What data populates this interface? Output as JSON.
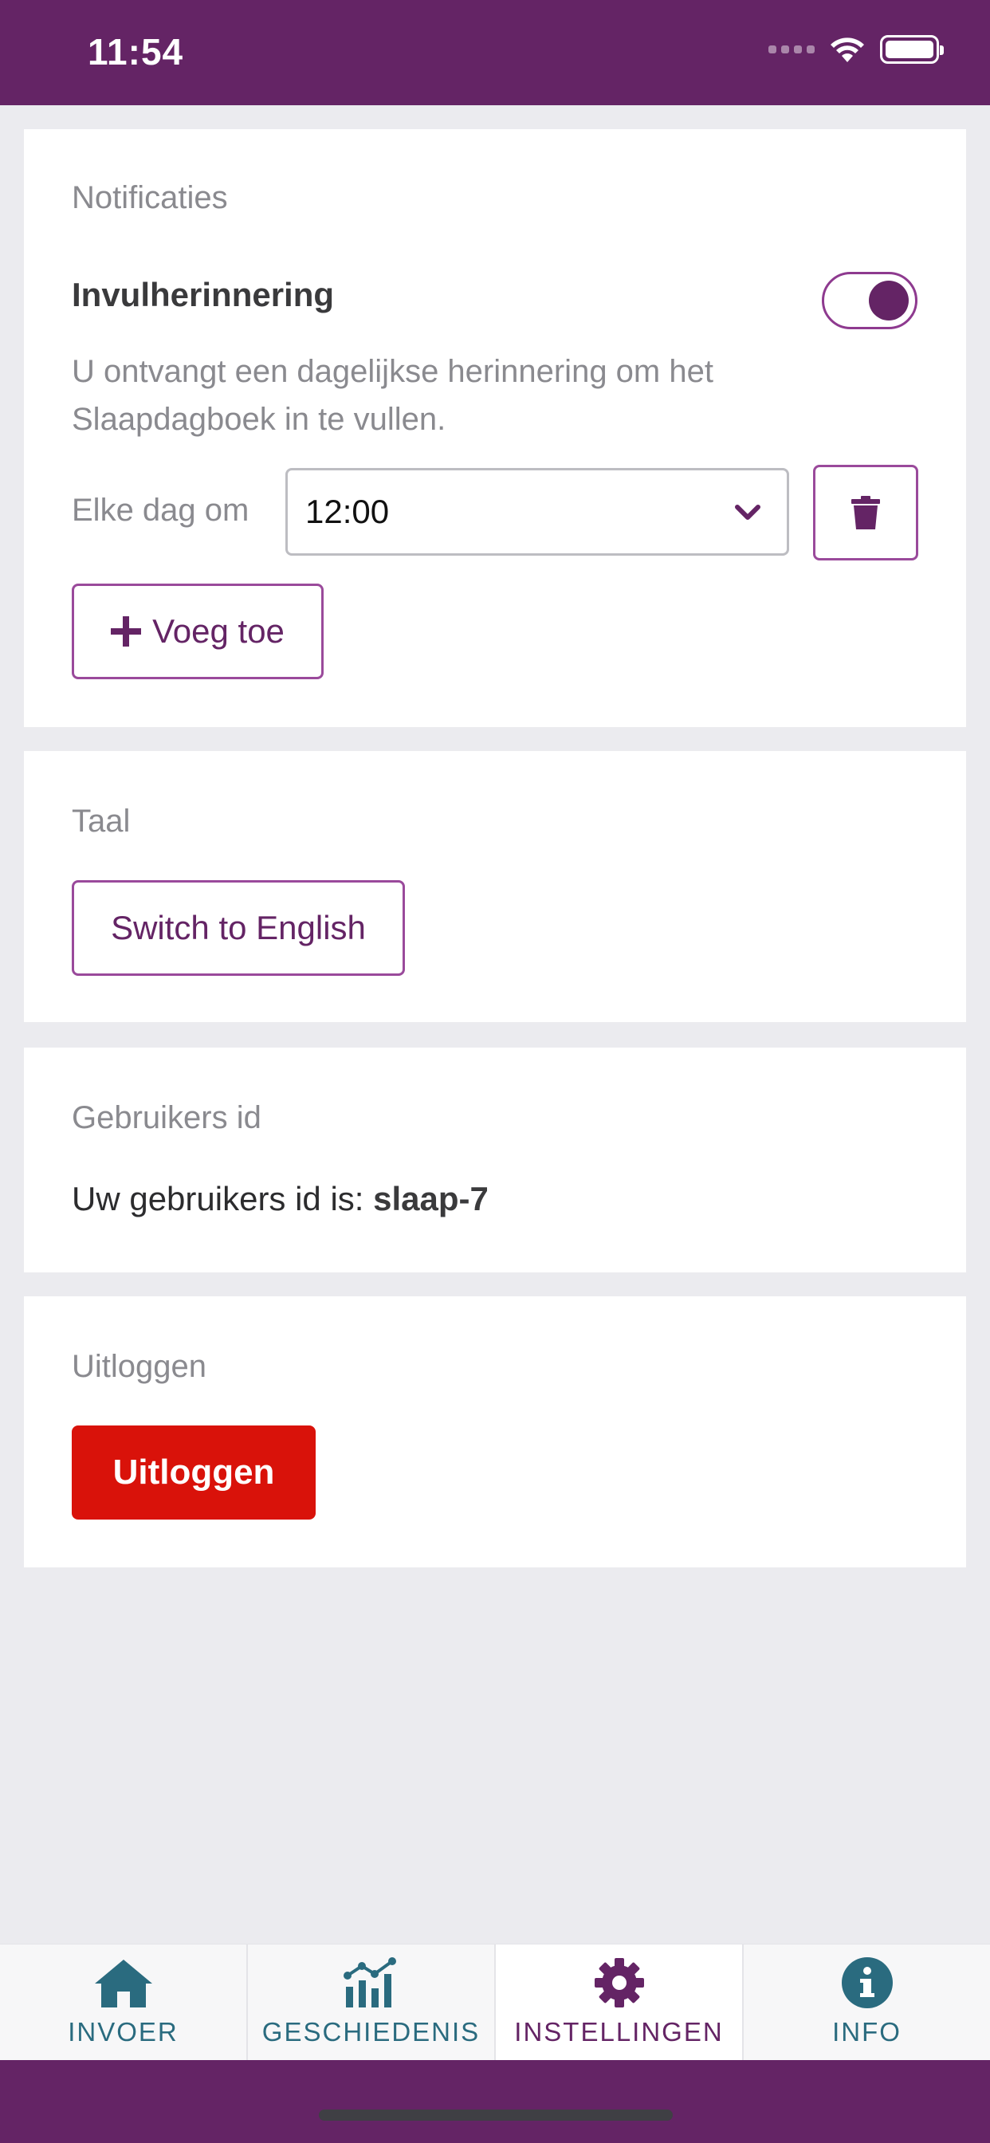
{
  "status": {
    "time": "11:54"
  },
  "notifications": {
    "section_title": "Notificaties",
    "reminder_title": "Invulherinnering",
    "reminder_enabled": true,
    "description_line1": "U ontvangt een dagelijkse herinnering om het",
    "description_line2": "Slaapdagboek in te vullen.",
    "daily_label": "Elke dag om",
    "time_value": "12:00",
    "add_label": "Voeg toe"
  },
  "language": {
    "section_title": "Taal",
    "switch_label": "Switch to English"
  },
  "user": {
    "section_title": "Gebruikers id",
    "id_prefix": "Uw gebruikers id is: ",
    "id_value": "slaap-7"
  },
  "logout": {
    "section_title": "Uitloggen",
    "button_label": "Uitloggen"
  },
  "tabs": [
    {
      "label": "INVOER",
      "icon": "home-icon"
    },
    {
      "label": "GESCHIEDENIS",
      "icon": "chart-icon"
    },
    {
      "label": "INSTELLINGEN",
      "icon": "gear-icon",
      "active": true
    },
    {
      "label": "INFO",
      "icon": "info-icon"
    }
  ],
  "colors": {
    "brand": "#642465",
    "danger": "#d9120a",
    "tab_inactive": "#2a6b7f"
  }
}
